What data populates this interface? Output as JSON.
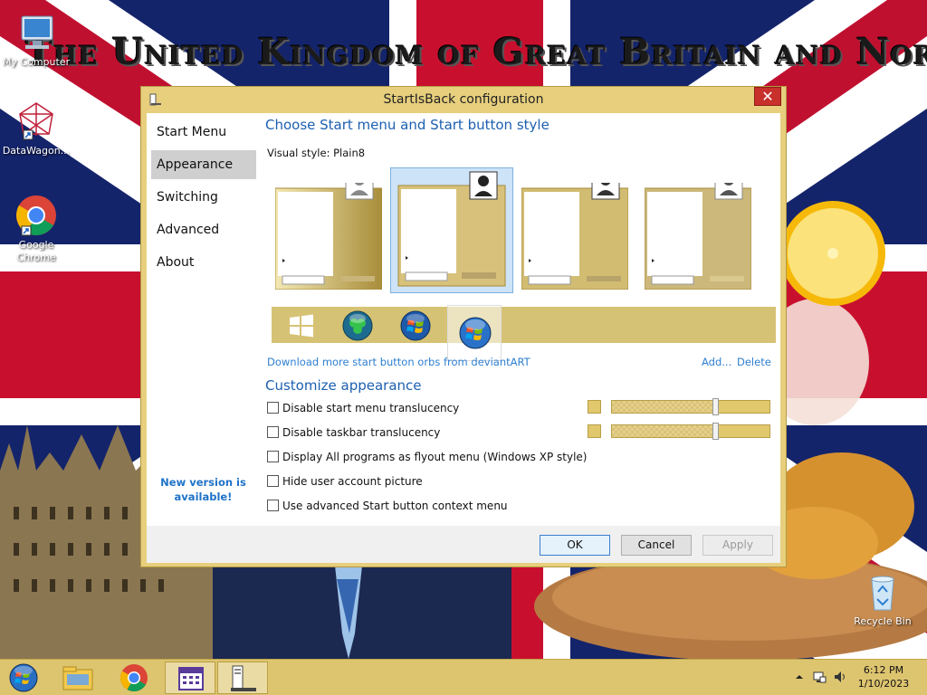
{
  "desktop": {
    "banner": "The United Kingdom of Great Britain and Northern Ireland",
    "icons": [
      {
        "label": "My Computer"
      },
      {
        "label": "DataWagon..."
      },
      {
        "label": "Google Chrome"
      },
      {
        "label": "Recycle Bin"
      }
    ]
  },
  "dialog": {
    "title": "StartIsBack configuration",
    "close_label": "✕",
    "nav": [
      {
        "label": "Start Menu"
      },
      {
        "label": "Appearance"
      },
      {
        "label": "Switching"
      },
      {
        "label": "Advanced"
      },
      {
        "label": "About"
      }
    ],
    "selected_nav": "Appearance",
    "new_version": "New version is available!",
    "style_section_title": "Choose Start menu and Start button style",
    "visual_style_label": "Visual style:  Plain8",
    "download_link": "Download more start button orbs from deviantART",
    "add_link": "Add...",
    "delete_link": "Delete",
    "customize_title": "Customize appearance",
    "checkboxes": [
      {
        "label": "Disable start menu translucency",
        "checked": false
      },
      {
        "label": "Disable taskbar translucency",
        "checked": false
      },
      {
        "label": "Display All programs as flyout menu (Windows XP style)",
        "checked": false
      },
      {
        "label": "Hide user account picture",
        "checked": false
      },
      {
        "label": "Use advanced Start button context menu",
        "checked": false
      }
    ],
    "buttons": {
      "ok": "OK",
      "cancel": "Cancel",
      "apply": "Apply"
    }
  },
  "taskbar": {
    "time": "6:12 PM",
    "date": "1/10/2023"
  },
  "colors": {
    "accent": "#e1c86d",
    "link": "#2e7fd1",
    "section_title": "#1d5fb0",
    "close": "#c7302b"
  }
}
